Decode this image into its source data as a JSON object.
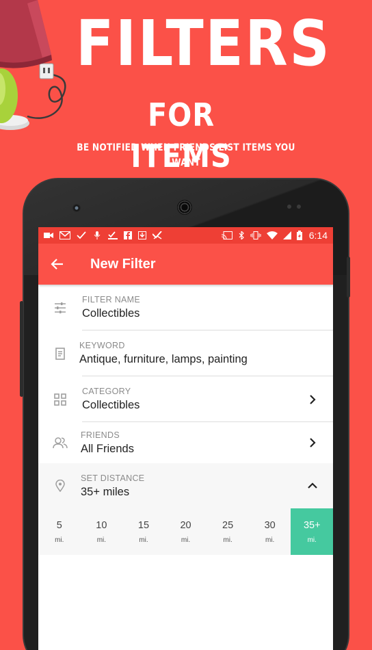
{
  "promo": {
    "title": "FILTERS",
    "subtitle": "FOR ITEMS",
    "tagline": "BE NOTIFIED WHEN FRIENDS LIST ITEMS YOU WANT"
  },
  "colors": {
    "background": "#fb5148",
    "statusbar": "#ee3f35",
    "appbar": "#fb5148",
    "selected": "#45c99f"
  },
  "statusbar": {
    "time": "6:14",
    "left_icons": [
      "video-icon",
      "gmail-icon",
      "check-icon",
      "mic-icon",
      "task-icon",
      "facebook-icon",
      "download-icon",
      "app-check-icon"
    ],
    "right_icons": [
      "cast-icon",
      "bluetooth-icon",
      "vibrate-icon",
      "wifi-icon",
      "signal-icon",
      "battery-icon"
    ]
  },
  "appbar": {
    "title": "New Filter"
  },
  "fields": {
    "filter_name": {
      "label": "FILTER NAME",
      "value": "Collectibles"
    },
    "keyword": {
      "label": "KEYWORD",
      "value": "Antique, furniture, lamps, painting"
    },
    "category": {
      "label": "CATEGORY",
      "value": "Collectibles"
    },
    "friends": {
      "label": "FRIENDS",
      "value": "All Friends"
    },
    "distance": {
      "label": "SET DISTANCE",
      "value": "35+ miles"
    }
  },
  "distance_options": [
    {
      "num": "5",
      "unit": "mi."
    },
    {
      "num": "10",
      "unit": "mi."
    },
    {
      "num": "15",
      "unit": "mi."
    },
    {
      "num": "20",
      "unit": "mi."
    },
    {
      "num": "25",
      "unit": "mi."
    },
    {
      "num": "30",
      "unit": "mi."
    },
    {
      "num": "35+",
      "unit": "mi."
    }
  ],
  "selected_distance_index": 6
}
